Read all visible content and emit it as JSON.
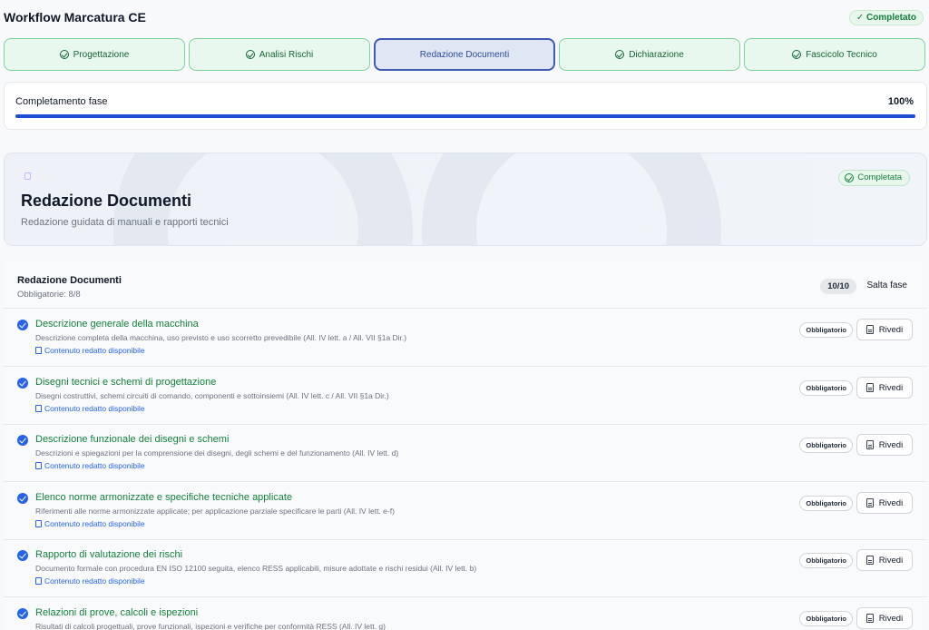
{
  "header": {
    "title": "Workflow Marcatura CE",
    "status": "✓ Completato"
  },
  "steps": [
    {
      "label": "Progettazione",
      "state": "done"
    },
    {
      "label": "Analisi Rischi",
      "state": "done"
    },
    {
      "label": "Redazione Documenti",
      "state": "active"
    },
    {
      "label": "Dichiarazione",
      "state": "done"
    },
    {
      "label": "Fascicolo Tecnico",
      "state": "done"
    }
  ],
  "progress": {
    "label": "Completamento fase",
    "percent_text": "100%",
    "value": 1.0
  },
  "hero": {
    "title": "Redazione Documenti",
    "subtitle": "Redazione guidata di manuali e rapporti tecnici",
    "badge": "Completata",
    "icon": "document-icon"
  },
  "section": {
    "title": "Redazione Documenti",
    "subtitle": "Obbligatorie: 8/8",
    "count": "10/10",
    "skip_label": "Salta fase",
    "mandatory_label": "Obbligatorio",
    "review_label": "Rivedi",
    "link_label": "Contenuto redatto disponibile"
  },
  "items": [
    {
      "title": "Descrizione generale della macchina",
      "desc": "Descrizione completa della macchina, uso previsto e uso scorretto prevedibile (All. IV lett. a / All. VII §1a Dir.)"
    },
    {
      "title": "Disegni tecnici e schemi di progettazione",
      "desc": "Disegni costruttivi, schemi circuiti di comando, componenti e sottoinsiemi (All. IV lett. c / All. VII §1a Dir.)"
    },
    {
      "title": "Descrizione funzionale dei disegni e schemi",
      "desc": "Descrizioni e spiegazioni per la comprensione dei disegni, degli schemi e del funzionamento (All. IV lett. d)"
    },
    {
      "title": "Elenco norme armonizzate e specifiche tecniche applicate",
      "desc": "Riferimenti alle norme armonizzate applicate; per applicazione parziale specificare le parti (All. IV lett. e-f)"
    },
    {
      "title": "Rapporto di valutazione dei rischi",
      "desc": "Documento formale con procedura EN ISO 12100 seguita, elenco RESS applicabili, misure adottate e rischi residui (All. IV lett. b)"
    },
    {
      "title": "Relazioni di prove, calcoli e ispezioni",
      "desc": "Risultati di calcoli progettuali, prove funzionali, ispezioni e verifiche per conformità RESS (All. IV lett. g)"
    }
  ],
  "colors": {
    "accent": "#1d4ed8",
    "success": "#15803d",
    "step_done_bg": "#e9f8ee",
    "step_active_bg": "#e0e6f4"
  }
}
